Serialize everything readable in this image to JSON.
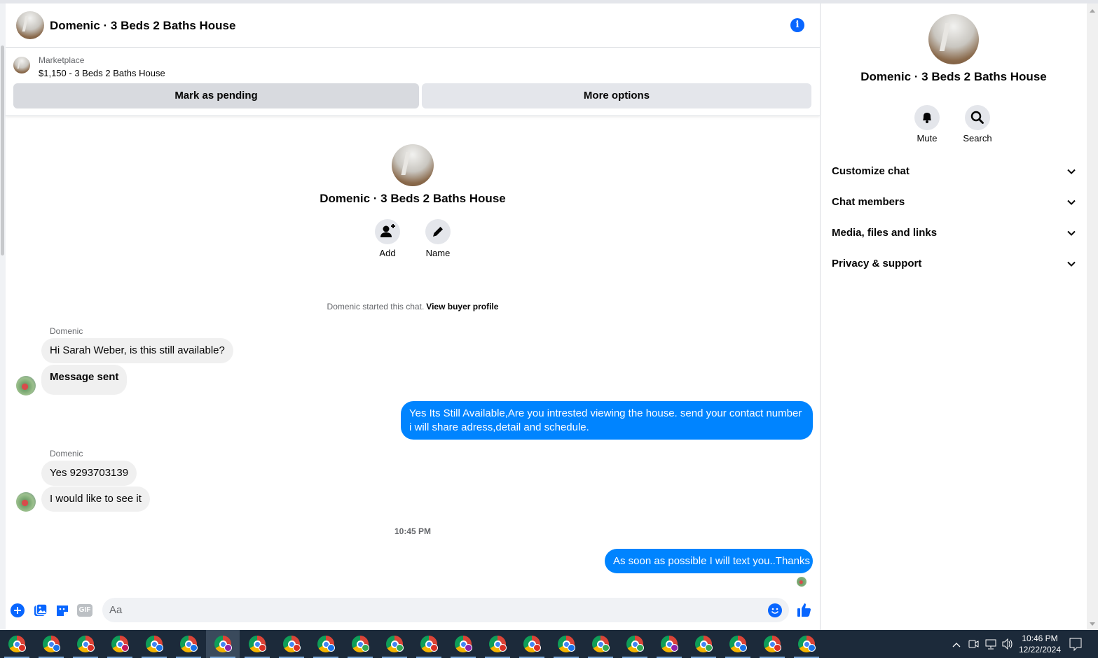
{
  "header": {
    "title": "Domenic · 3 Beds 2 Baths House",
    "info_icon": "info-icon"
  },
  "marketplace": {
    "source": "Marketplace",
    "listing": "$1,150 - 3 Beds 2 Baths House",
    "pending_label": "Mark as pending",
    "more_label": "More options"
  },
  "intro": {
    "title": "Domenic · 3 Beds 2 Baths House",
    "add_label": "Add",
    "name_label": "Name",
    "started_text": "Domenic started this chat.",
    "view_profile": "View buyer profile"
  },
  "messages": [
    {
      "sender": "Domenic",
      "direction": "in",
      "text": "Hi Sarah Weber, is this still available?"
    },
    {
      "direction": "in",
      "text": "Message sent",
      "bold": true
    },
    {
      "direction": "out",
      "text": "Yes Its Still Available,Are you intrested viewing the house. send your contact number i will share adress,detail and schedule."
    },
    {
      "sender": "Domenic",
      "direction": "in",
      "text": "Yes 9293703139"
    },
    {
      "direction": "in",
      "text": "I would like to see it"
    },
    {
      "direction": "out",
      "text": "As soon as possible I will text you..Thanks"
    }
  ],
  "timestamp": "10:45 PM",
  "composer": {
    "placeholder": "Aa",
    "icons": [
      "plus-icon",
      "photo-icon",
      "sticker-icon",
      "gif-icon",
      "emoji-icon",
      "like-icon"
    ],
    "gif_label": "GIF"
  },
  "side_panel": {
    "title": "Domenic · 3 Beds 2 Baths House",
    "mute_label": "Mute",
    "search_label": "Search",
    "sections": [
      "Customize chat",
      "Chat members",
      "Media, files and links",
      "Privacy & support"
    ]
  },
  "taskbar": {
    "time": "10:46 PM",
    "date": "12/22/2024",
    "app_count": 24,
    "active_index": 6,
    "badge_colors": [
      "#d93025",
      "#1a73e8",
      "#d93025",
      "#c2185b",
      "#1a73e8",
      "#1a73e8",
      "#8e24aa",
      "#d93025",
      "#d93025",
      "#1a73e8",
      "#34a853",
      "#34a853",
      "#d93025",
      "#8e24aa",
      "#d93025",
      "#d93025",
      "#1a73e8",
      "#34a853",
      "#34a853",
      "#8e24aa",
      "#34a853",
      "#1a73e8",
      "#d93025",
      "#1a73e8",
      "#1a73e8"
    ]
  },
  "colors": {
    "accent": "#0866ff",
    "outgoing_bubble": "#0084ff",
    "incoming_bubble": "#f0f0f0"
  }
}
